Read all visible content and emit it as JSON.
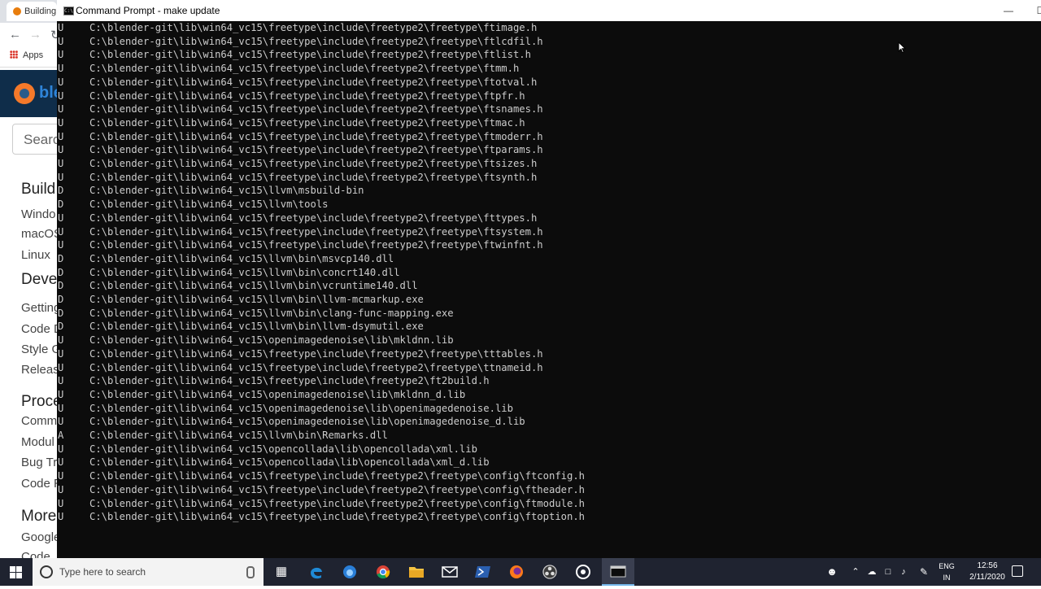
{
  "browser": {
    "tab_title": "Building",
    "bookmarks_apps": "Apps",
    "logo_text": "ble",
    "search_placeholder": "Search",
    "sidebar": [
      {
        "kind": "heading",
        "label": "Build"
      },
      {
        "kind": "item",
        "label": "Windo"
      },
      {
        "kind": "item",
        "label": "macOS"
      },
      {
        "kind": "item",
        "label": "Linux"
      },
      {
        "kind": "heading",
        "label": "Deve"
      },
      {
        "kind": "item",
        "label": "Getting"
      },
      {
        "kind": "item",
        "label": "Code D"
      },
      {
        "kind": "item",
        "label": "Style G"
      },
      {
        "kind": "item",
        "label": "Release"
      },
      {
        "kind": "heading",
        "label": "Proce"
      },
      {
        "kind": "item",
        "label": "Comm"
      },
      {
        "kind": "item",
        "label": "Modul"
      },
      {
        "kind": "item",
        "label": "Bug Tr"
      },
      {
        "kind": "item",
        "label": "Code R"
      },
      {
        "kind": "heading",
        "label": "More"
      },
      {
        "kind": "item",
        "label": "Google"
      },
      {
        "kind": "item",
        "label": "Code"
      }
    ]
  },
  "console": {
    "title": "Command Prompt - make  update",
    "lines": [
      {
        "status": "U",
        "path": "C:\\blender-git\\lib\\win64_vc15\\freetype\\include\\freetype2\\freetype\\ftimage.h"
      },
      {
        "status": "U",
        "path": "C:\\blender-git\\lib\\win64_vc15\\freetype\\include\\freetype2\\freetype\\ftlcdfil.h"
      },
      {
        "status": "U",
        "path": "C:\\blender-git\\lib\\win64_vc15\\freetype\\include\\freetype2\\freetype\\ftlist.h"
      },
      {
        "status": "U",
        "path": "C:\\blender-git\\lib\\win64_vc15\\freetype\\include\\freetype2\\freetype\\ftmm.h"
      },
      {
        "status": "U",
        "path": "C:\\blender-git\\lib\\win64_vc15\\freetype\\include\\freetype2\\freetype\\ftotval.h"
      },
      {
        "status": "U",
        "path": "C:\\blender-git\\lib\\win64_vc15\\freetype\\include\\freetype2\\freetype\\ftpfr.h"
      },
      {
        "status": "U",
        "path": "C:\\blender-git\\lib\\win64_vc15\\freetype\\include\\freetype2\\freetype\\ftsnames.h"
      },
      {
        "status": "U",
        "path": "C:\\blender-git\\lib\\win64_vc15\\freetype\\include\\freetype2\\freetype\\ftmac.h"
      },
      {
        "status": "U",
        "path": "C:\\blender-git\\lib\\win64_vc15\\freetype\\include\\freetype2\\freetype\\ftmoderr.h"
      },
      {
        "status": "U",
        "path": "C:\\blender-git\\lib\\win64_vc15\\freetype\\include\\freetype2\\freetype\\ftparams.h"
      },
      {
        "status": "U",
        "path": "C:\\blender-git\\lib\\win64_vc15\\freetype\\include\\freetype2\\freetype\\ftsizes.h"
      },
      {
        "status": "U",
        "path": "C:\\blender-git\\lib\\win64_vc15\\freetype\\include\\freetype2\\freetype\\ftsynth.h"
      },
      {
        "status": "D",
        "path": "C:\\blender-git\\lib\\win64_vc15\\llvm\\msbuild-bin"
      },
      {
        "status": "D",
        "path": "C:\\blender-git\\lib\\win64_vc15\\llvm\\tools"
      },
      {
        "status": "U",
        "path": "C:\\blender-git\\lib\\win64_vc15\\freetype\\include\\freetype2\\freetype\\fttypes.h"
      },
      {
        "status": "U",
        "path": "C:\\blender-git\\lib\\win64_vc15\\freetype\\include\\freetype2\\freetype\\ftsystem.h"
      },
      {
        "status": "U",
        "path": "C:\\blender-git\\lib\\win64_vc15\\freetype\\include\\freetype2\\freetype\\ftwinfnt.h"
      },
      {
        "status": "D",
        "path": "C:\\blender-git\\lib\\win64_vc15\\llvm\\bin\\msvcp140.dll"
      },
      {
        "status": "D",
        "path": "C:\\blender-git\\lib\\win64_vc15\\llvm\\bin\\concrt140.dll"
      },
      {
        "status": "D",
        "path": "C:\\blender-git\\lib\\win64_vc15\\llvm\\bin\\vcruntime140.dll"
      },
      {
        "status": "D",
        "path": "C:\\blender-git\\lib\\win64_vc15\\llvm\\bin\\llvm-mcmarkup.exe"
      },
      {
        "status": "D",
        "path": "C:\\blender-git\\lib\\win64_vc15\\llvm\\bin\\clang-func-mapping.exe"
      },
      {
        "status": "D",
        "path": "C:\\blender-git\\lib\\win64_vc15\\llvm\\bin\\llvm-dsymutil.exe"
      },
      {
        "status": "U",
        "path": "C:\\blender-git\\lib\\win64_vc15\\openimagedenoise\\lib\\mkldnn.lib"
      },
      {
        "status": "U",
        "path": "C:\\blender-git\\lib\\win64_vc15\\freetype\\include\\freetype2\\freetype\\tttables.h"
      },
      {
        "status": "U",
        "path": "C:\\blender-git\\lib\\win64_vc15\\freetype\\include\\freetype2\\freetype\\ttnameid.h"
      },
      {
        "status": "U",
        "path": "C:\\blender-git\\lib\\win64_vc15\\freetype\\include\\freetype2\\ft2build.h"
      },
      {
        "status": "U",
        "path": "C:\\blender-git\\lib\\win64_vc15\\openimagedenoise\\lib\\mkldnn_d.lib"
      },
      {
        "status": "U",
        "path": "C:\\blender-git\\lib\\win64_vc15\\openimagedenoise\\lib\\openimagedenoise.lib"
      },
      {
        "status": "U",
        "path": "C:\\blender-git\\lib\\win64_vc15\\openimagedenoise\\lib\\openimagedenoise_d.lib"
      },
      {
        "status": "A",
        "path": "C:\\blender-git\\lib\\win64_vc15\\llvm\\bin\\Remarks.dll"
      },
      {
        "status": "U",
        "path": "C:\\blender-git\\lib\\win64_vc15\\opencollada\\lib\\opencollada\\xml.lib"
      },
      {
        "status": "U",
        "path": "C:\\blender-git\\lib\\win64_vc15\\opencollada\\lib\\opencollada\\xml_d.lib"
      },
      {
        "status": "U",
        "path": "C:\\blender-git\\lib\\win64_vc15\\freetype\\include\\freetype2\\freetype\\config\\ftconfig.h"
      },
      {
        "status": "U",
        "path": "C:\\blender-git\\lib\\win64_vc15\\freetype\\include\\freetype2\\freetype\\config\\ftheader.h"
      },
      {
        "status": "U",
        "path": "C:\\blender-git\\lib\\win64_vc15\\freetype\\include\\freetype2\\freetype\\config\\ftmodule.h"
      },
      {
        "status": "U",
        "path": "C:\\blender-git\\lib\\win64_vc15\\freetype\\include\\freetype2\\freetype\\config\\ftoption.h"
      }
    ]
  },
  "taskbar": {
    "search_placeholder": "Type here to search",
    "apps": [
      "task-view-icon",
      "edge-icon",
      "firefox-dev-icon",
      "chrome-icon",
      "file-explorer-icon",
      "mail-icon",
      "powershell-icon",
      "firefox-icon",
      "obs-icon",
      "steam-icon",
      "terminal-icon"
    ],
    "lang_top": "ENG",
    "lang_bottom": "IN",
    "time": "12:56",
    "date": "2/11/2020"
  },
  "colors": {
    "console_bg": "#0c0c0c",
    "console_fg": "#cccccc",
    "taskbar_bg": "#1f2330",
    "browser_hero": "#0f2d4a",
    "blender_orange": "#f5792a"
  }
}
